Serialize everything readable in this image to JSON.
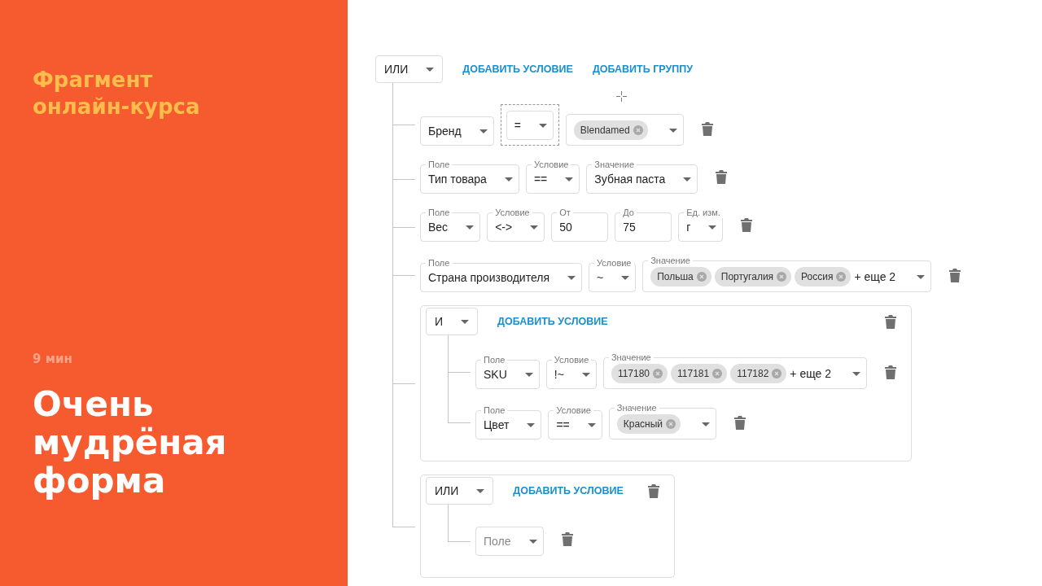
{
  "promo": {
    "kicker": "Фрагмент онлайн-курса",
    "duration": "9 мин",
    "title": "Очень мудрёная форма"
  },
  "builder": {
    "operator": "ИЛИ",
    "actions": {
      "add_condition": "ДОБАВИТЬ УСЛОВИЕ",
      "add_group": "ДОБАВИТЬ ГРУППУ"
    },
    "items": [
      {
        "kind": "condition",
        "fields": [
          {
            "kind": "select",
            "value": "Бренд",
            "focused": false
          },
          {
            "kind": "select",
            "value": "=",
            "focused": true
          },
          {
            "kind": "chips",
            "chips": [
              "Blendamed"
            ],
            "focused": false
          }
        ]
      },
      {
        "kind": "condition",
        "fields": [
          {
            "kind": "select",
            "label": "Поле",
            "value": "Тип товара",
            "focused": false
          },
          {
            "kind": "select",
            "label": "Условие",
            "value": "==",
            "focused": false
          },
          {
            "kind": "select",
            "label": "Значение",
            "value": "Зубная паста",
            "focused": false
          }
        ]
      },
      {
        "kind": "condition",
        "fields": [
          {
            "kind": "select",
            "label": "Поле",
            "value": "Вес",
            "focused": false
          },
          {
            "kind": "select",
            "label": "Условие",
            "value": "<->",
            "focused": false
          },
          {
            "kind": "input",
            "label": "От",
            "value": "50",
            "focused": false
          },
          {
            "kind": "input",
            "label": "До",
            "value": "75",
            "focused": false
          },
          {
            "kind": "select",
            "label": "Ед. изм.",
            "value": "г",
            "focused": false
          }
        ]
      },
      {
        "kind": "condition",
        "fields": [
          {
            "kind": "select",
            "label": "Поле",
            "value": "Страна производителя",
            "focused": false
          },
          {
            "kind": "select",
            "label": "Условие",
            "value": "~",
            "focused": false
          },
          {
            "kind": "chips",
            "label": "Значение",
            "chips": [
              "Польша",
              "Португалия",
              "Россия"
            ],
            "more": "+ еще 2",
            "focused": false
          }
        ]
      },
      {
        "kind": "group",
        "operator": "И",
        "actions": {
          "add_condition": "ДОБАВИТЬ УСЛОВИЕ"
        },
        "items": [
          {
            "kind": "condition",
            "fields": [
              {
                "kind": "select",
                "label": "Поле",
                "value": "SKU",
                "focused": false
              },
              {
                "kind": "select",
                "label": "Условие",
                "value": "!~",
                "focused": false
              },
              {
                "kind": "chips",
                "label": "Значение",
                "chips": [
                  "117180",
                  "117181",
                  "117182"
                ],
                "more": "+ еще 2",
                "focused": false
              }
            ]
          },
          {
            "kind": "condition",
            "fields": [
              {
                "kind": "select",
                "label": "Поле",
                "value": "Цвет",
                "focused": false
              },
              {
                "kind": "select",
                "label": "Условие",
                "value": "==",
                "focused": false
              },
              {
                "kind": "chips",
                "label": "Значение",
                "chips": [
                  "Красный"
                ],
                "focused": false
              }
            ]
          }
        ]
      },
      {
        "kind": "group",
        "operator": "ИЛИ",
        "actions": {
          "add_condition": "ДОБАВИТЬ УСЛОВИЕ"
        },
        "items": [
          {
            "kind": "condition",
            "fields": [
              {
                "kind": "select",
                "placeholder": "Поле",
                "focused": false
              }
            ]
          }
        ]
      }
    ]
  }
}
